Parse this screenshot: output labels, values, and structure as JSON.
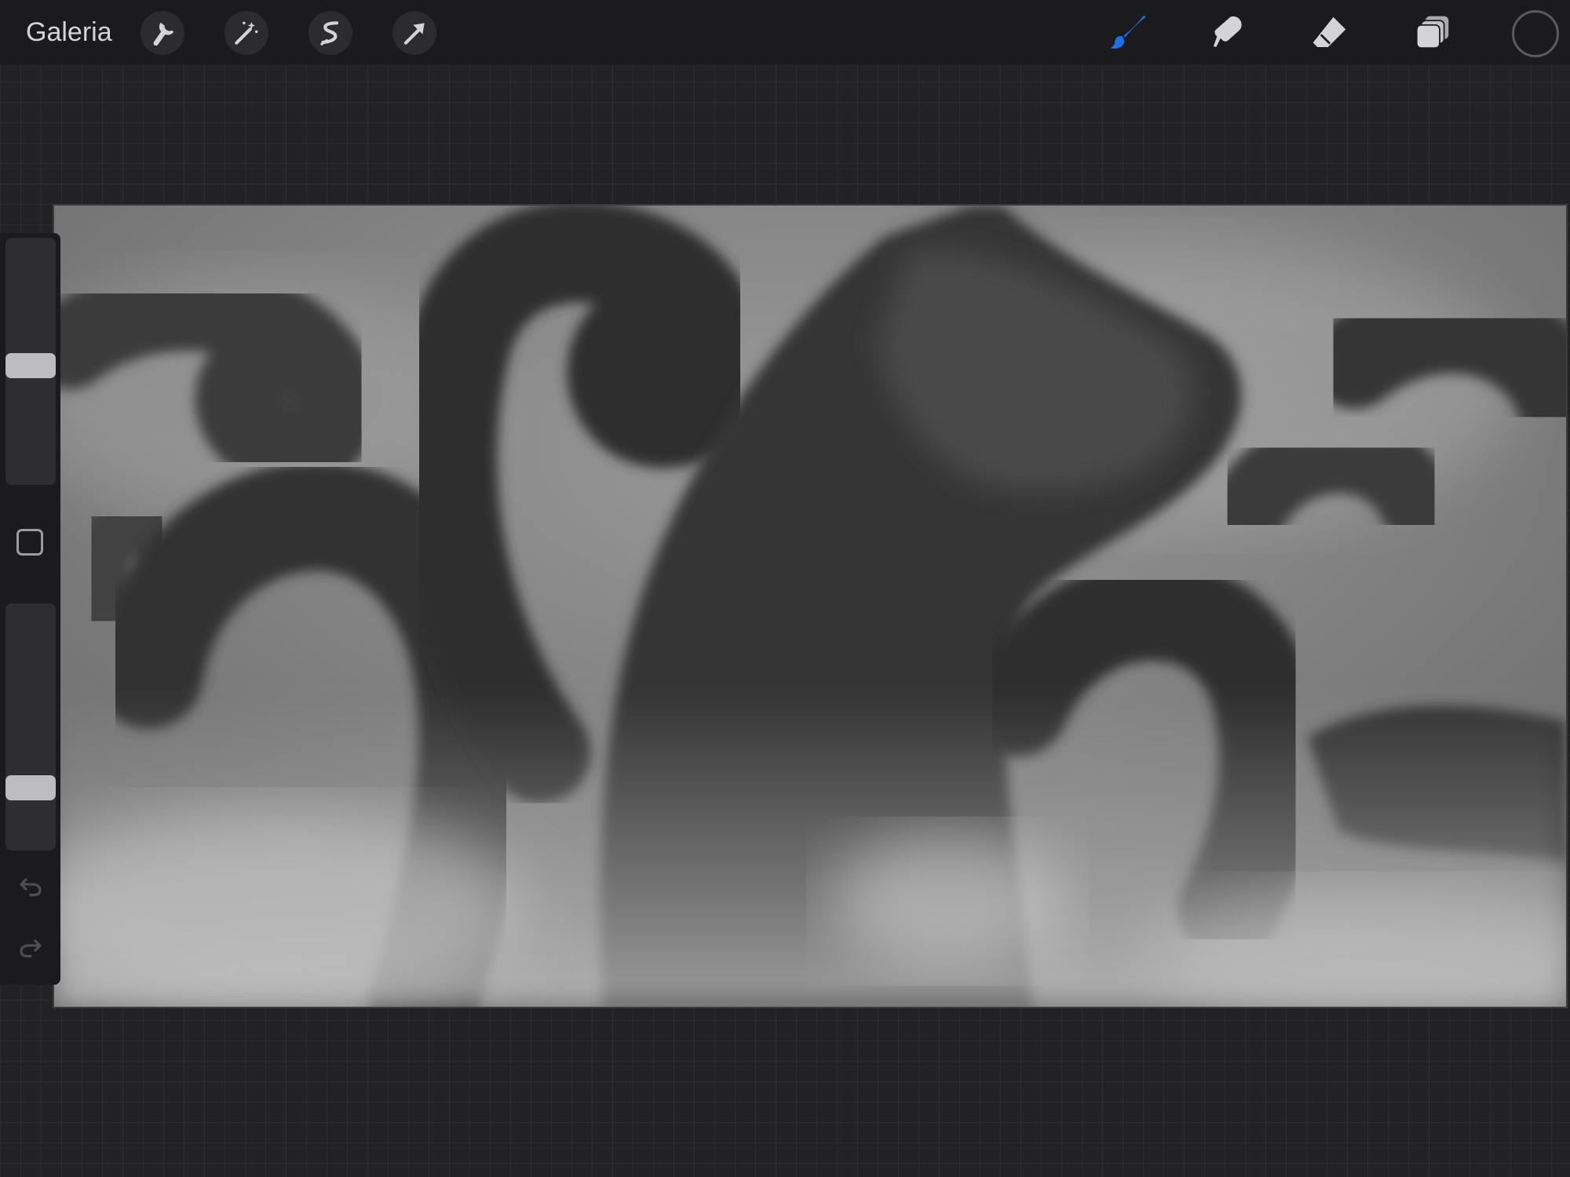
{
  "toolbar": {
    "gallery_label": "Galeria",
    "left_tools": [
      {
        "icon": "wrench-icon",
        "name": "actions"
      },
      {
        "icon": "magic-wand-icon",
        "name": "adjustments"
      },
      {
        "icon": "selection-s-icon",
        "name": "selection"
      },
      {
        "icon": "arrow-cursor-icon",
        "name": "transform"
      }
    ],
    "right_tools": [
      {
        "icon": "brush-icon",
        "name": "paint",
        "active": true
      },
      {
        "icon": "smudge-icon",
        "name": "smudge",
        "active": false
      },
      {
        "icon": "eraser-icon",
        "name": "eraser",
        "active": false
      },
      {
        "icon": "layers-icon",
        "name": "layers",
        "active": false
      }
    ],
    "active_color": "#1b1b1d",
    "accent_color": "#1e6fe8"
  },
  "sidebar": {
    "brush_size_level": 0.52,
    "opacity_level": 0.25,
    "modifier_icon": "square-modifier-icon",
    "undo_icon": "undo-icon",
    "redo_icon": "redo-icon"
  },
  "canvas": {
    "artwork": "grayscale-tentacle-painting"
  }
}
